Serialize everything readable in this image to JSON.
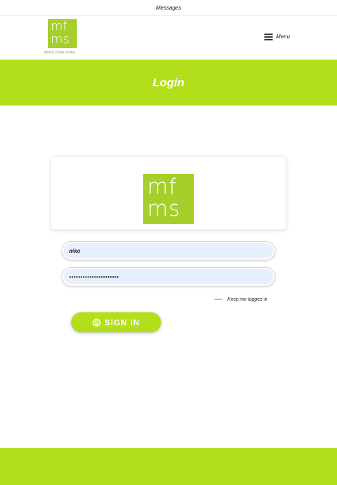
{
  "topbar": {
    "messages_label": "Messages"
  },
  "header": {
    "logo": {
      "line1": "mf",
      "line2": "ms",
      "caption": "MFMS Online Portal"
    },
    "menu_label": "Menu",
    "menu_icon": "hamburger-icon"
  },
  "hero": {
    "title": "Login"
  },
  "login_card": {
    "logo": {
      "line1": "mf",
      "line2": "ms"
    }
  },
  "form": {
    "username_value": "niko",
    "password_value": "••••••••••••••••••••••",
    "remember_label": "Keep me logged in",
    "signin_label": "SIGN IN",
    "signin_icon": "user-circle-icon"
  },
  "colors": {
    "brand_green": "#b3de1c",
    "logo_green": "#a6cf2b",
    "field_fill": "#e8f0fe"
  }
}
